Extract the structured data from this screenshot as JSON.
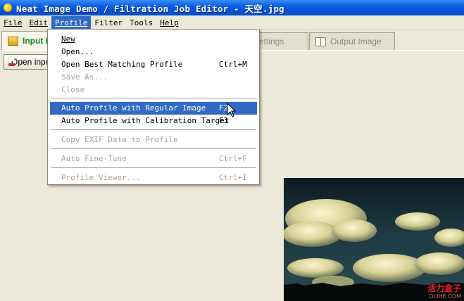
{
  "window": {
    "title": "Neat Image Demo / Filtration Job Editor - 天空.jpg"
  },
  "menubar": {
    "items": [
      {
        "label": "File"
      },
      {
        "label": "Edit"
      },
      {
        "label": "Profile"
      },
      {
        "label": "Filter"
      },
      {
        "label": "Tools"
      },
      {
        "label": "Help"
      }
    ]
  },
  "tabs": [
    {
      "label": "Input Image"
    },
    {
      "label": "Filter Settings"
    },
    {
      "label": "Output Image"
    }
  ],
  "toolbar": {
    "open_label": "Open input image"
  },
  "profile_menu": {
    "items": [
      {
        "label": "New",
        "shortcut": "",
        "enabled": true
      },
      {
        "label": "Open...",
        "shortcut": "",
        "enabled": true
      },
      {
        "label": "Open Best Matching Profile",
        "shortcut": "Ctrl+M",
        "enabled": true
      },
      {
        "label": "Save As...",
        "shortcut": "",
        "enabled": false
      },
      {
        "label": "Close",
        "shortcut": "",
        "enabled": false
      },
      {
        "label": "Auto Profile with Regular Image",
        "shortcut": "F2",
        "enabled": true,
        "highlighted": true
      },
      {
        "label": "Auto Profile with Calibration Target",
        "shortcut": "F3",
        "enabled": true
      },
      {
        "label": "Copy EXIF Data to Profile",
        "shortcut": "",
        "enabled": false
      },
      {
        "label": "Auto Fine-Tune",
        "shortcut": "Ctrl+F",
        "enabled": false
      },
      {
        "label": "Profile Viewer...",
        "shortcut": "Ctrl+I",
        "enabled": false
      }
    ]
  },
  "watermark": {
    "main": "活力盒子",
    "sub": "OLIHE.COM"
  },
  "colors": {
    "highlight": "#316ac5",
    "titlebar": "#0a5fe0",
    "active_tab_text": "#1a8a1a",
    "face": "#ece9d8"
  }
}
